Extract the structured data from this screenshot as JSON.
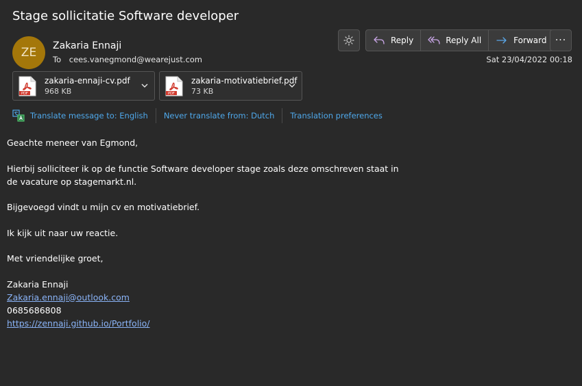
{
  "email": {
    "subject": "Stage sollicitatie Software developer",
    "sender": {
      "initials": "ZE",
      "name": "Zakaria Ennaji",
      "avatar_color": "#a4770a"
    },
    "to_label": "To",
    "to_address": "cees.vanegmond@wearejust.com",
    "date": "Sat 23/04/2022 00:18"
  },
  "actions": {
    "theme_icon": "sun-icon",
    "reply_label": "Reply",
    "reply_all_label": "Reply All",
    "forward_label": "Forward",
    "more_icon": "ellipsis-icon",
    "more_label": "···"
  },
  "attachments": [
    {
      "name": "zakaria-ennaji-cv.pdf",
      "size": "968 KB",
      "icon": "pdf-icon"
    },
    {
      "name": "zakaria-motivatiebrief.pdf",
      "size": "73 KB",
      "icon": "pdf-icon"
    }
  ],
  "translation": {
    "translate_label": "Translate message to: English",
    "never_label": "Never translate from: Dutch",
    "prefs_label": "Translation preferences",
    "link_color": "#4fa9ec"
  },
  "body": {
    "greeting": "Geachte meneer van Egmond,",
    "paragraph1": "Hierbij solliciteer ik op de functie Software developer stage zoals deze omschreven staat in de vacature op stagemarkt.nl.",
    "paragraph2": "Bijgevoegd vindt u mijn cv en motivatiebrief.",
    "paragraph3": "Ik kijk uit naar uw reactie.",
    "closing": "Met vriendelijke groet,",
    "signature_name": "Zakaria Ennaji",
    "signature_email": "Zakaria.ennaji@outlook.com",
    "signature_phone": "0685686808",
    "signature_url": "https://zennaji.github.io/Portfolio/"
  }
}
